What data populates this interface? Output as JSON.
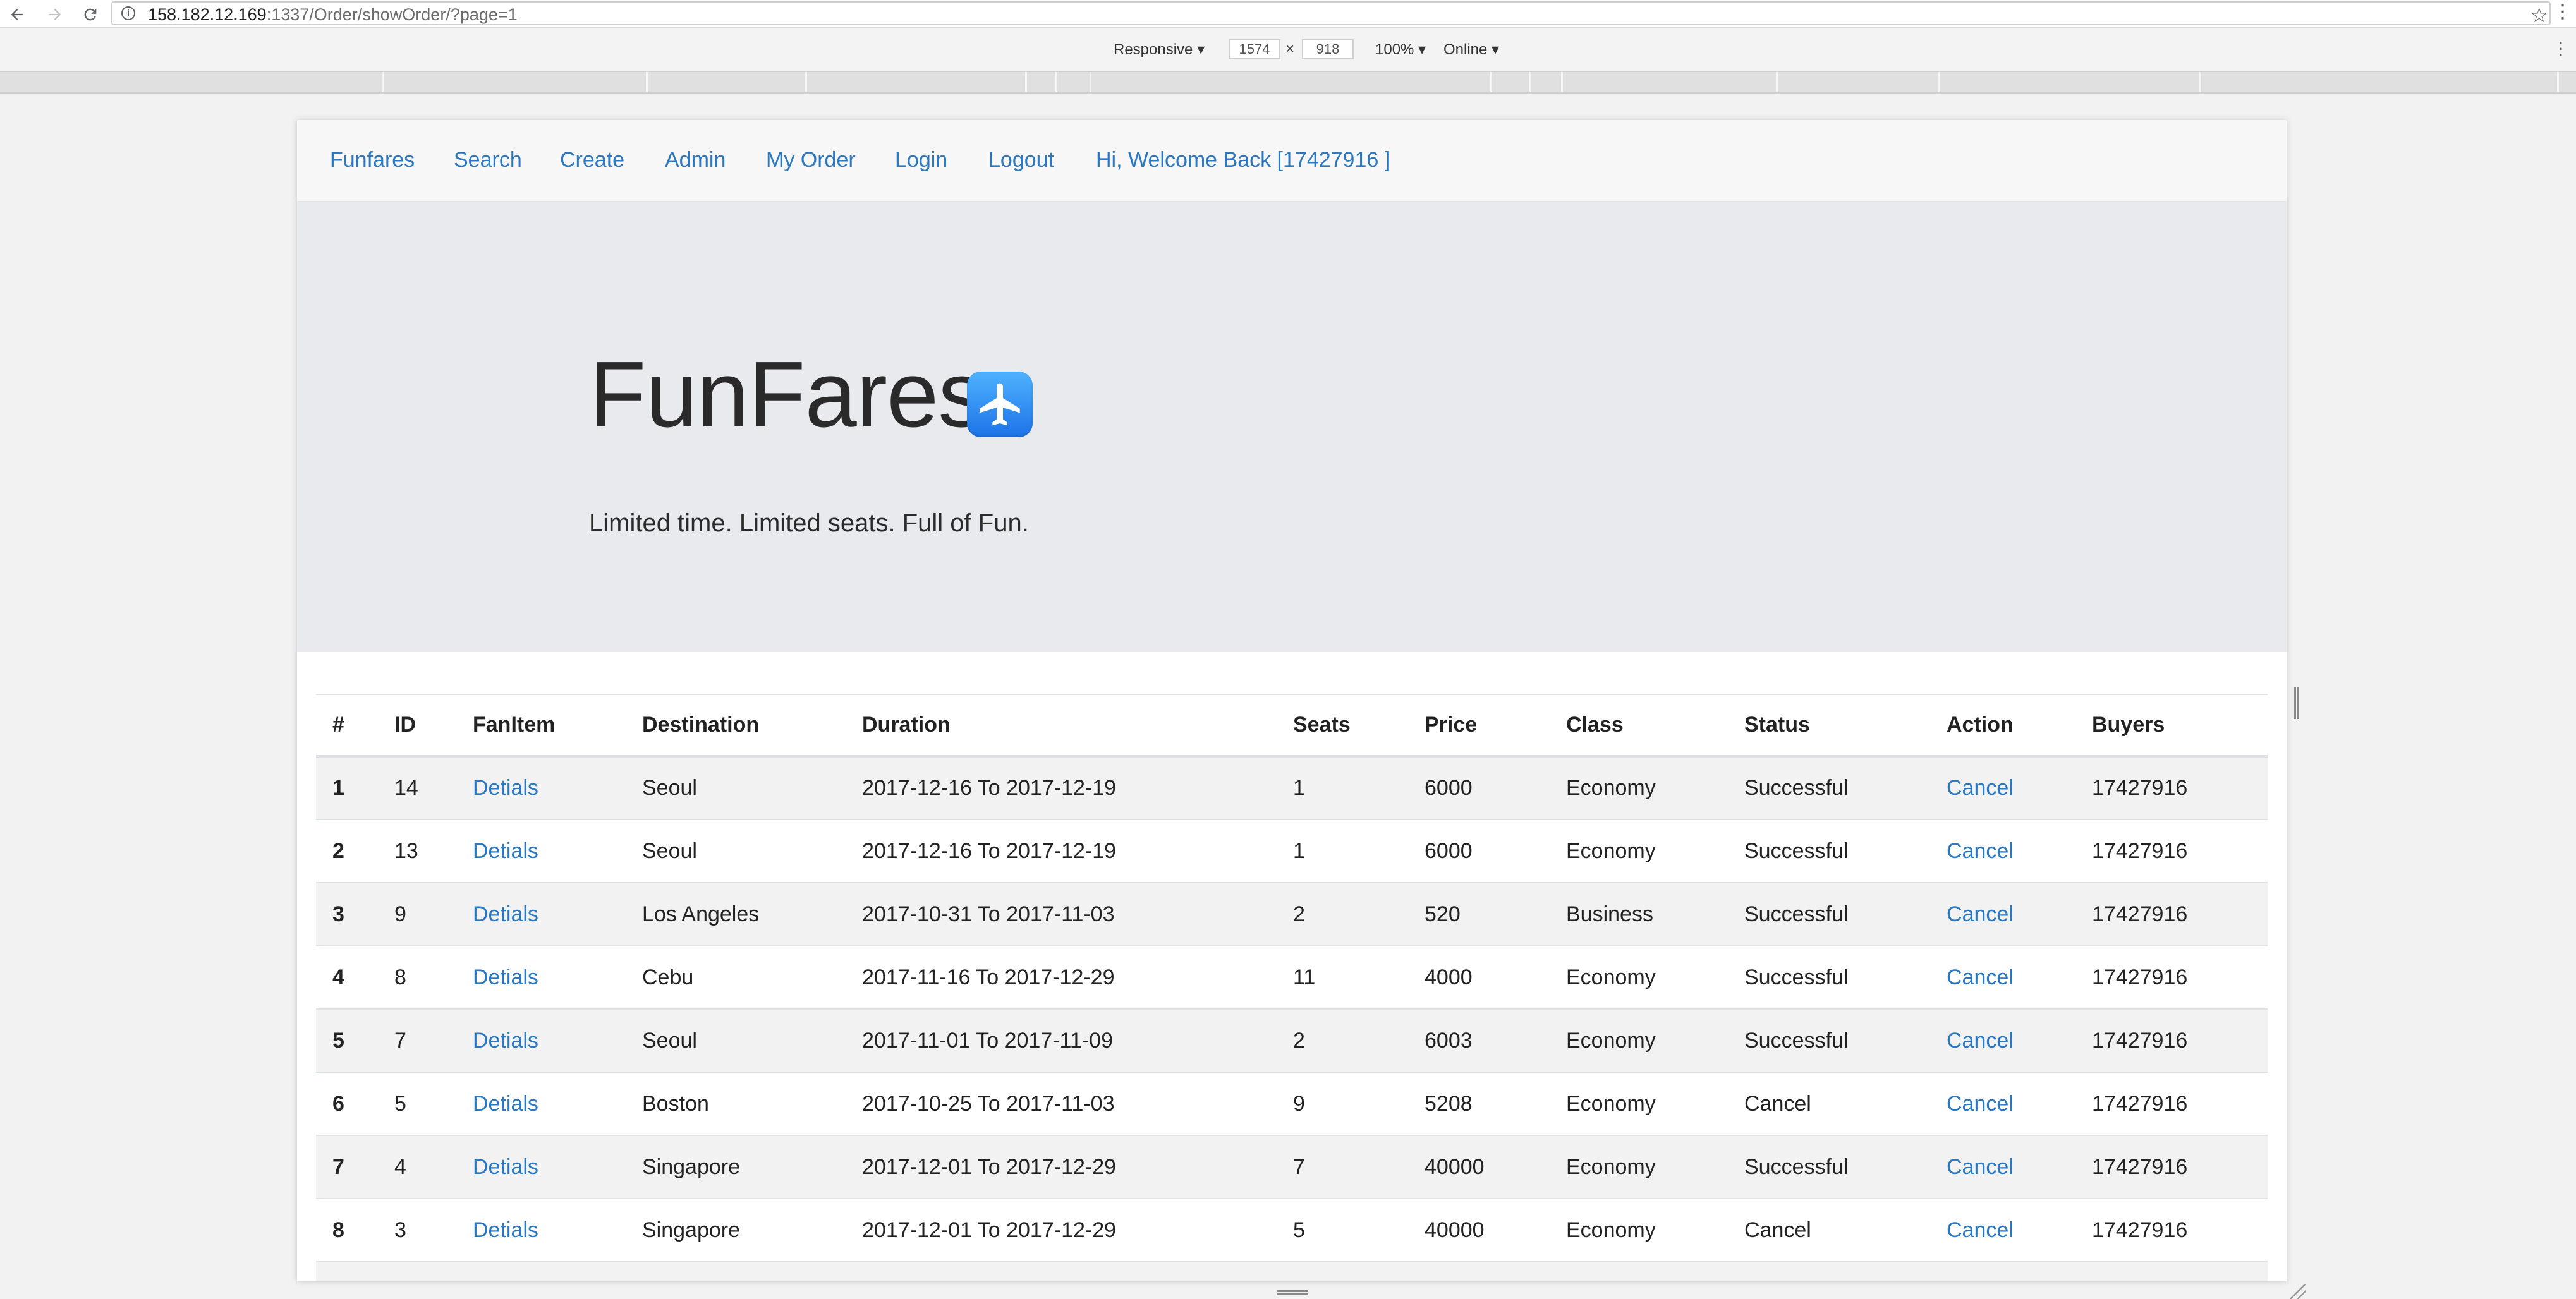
{
  "browser": {
    "url_host": "158.182.12.169",
    "url_path": ":1337/Order/showOrder/?page=1"
  },
  "device_toolbar": {
    "mode": "Responsive ▾",
    "width": "1574",
    "times": "×",
    "height": "918",
    "zoom": "100% ▾",
    "network": "Online ▾"
  },
  "navbar": {
    "items": [
      {
        "label": "Funfares"
      },
      {
        "label": "Search"
      },
      {
        "label": "Create"
      },
      {
        "label": "Admin"
      },
      {
        "label": "My Order"
      },
      {
        "label": "Login"
      },
      {
        "label": "Logout"
      },
      {
        "label": "Hi, Welcome Back [17427916 ]"
      }
    ]
  },
  "hero": {
    "title": "FunFares",
    "icon": "airplane-icon",
    "tagline": "Limited time. Limited seats. Full of Fun."
  },
  "table": {
    "headers": [
      "#",
      "ID",
      "FanItem",
      "Destination",
      "Duration",
      "Seats",
      "Price",
      "Class",
      "Status",
      "Action",
      "Buyers"
    ],
    "rows": [
      {
        "n": "1",
        "id": "14",
        "item": "Detials",
        "dest": "Seoul",
        "duration": "2017-12-16 To 2017-12-19",
        "seats": "1",
        "price": "6000",
        "cls": "Economy",
        "status": "Successful",
        "action": "Cancel",
        "buyer": "17427916"
      },
      {
        "n": "2",
        "id": "13",
        "item": "Detials",
        "dest": "Seoul",
        "duration": "2017-12-16 To 2017-12-19",
        "seats": "1",
        "price": "6000",
        "cls": "Economy",
        "status": "Successful",
        "action": "Cancel",
        "buyer": "17427916"
      },
      {
        "n": "3",
        "id": "9",
        "item": "Detials",
        "dest": "Los Angeles",
        "duration": "2017-10-31 To 2017-11-03",
        "seats": "2",
        "price": "520",
        "cls": "Business",
        "status": "Successful",
        "action": "Cancel",
        "buyer": "17427916"
      },
      {
        "n": "4",
        "id": "8",
        "item": "Detials",
        "dest": "Cebu",
        "duration": "2017-11-16 To 2017-12-29",
        "seats": "11",
        "price": "4000",
        "cls": "Economy",
        "status": "Successful",
        "action": "Cancel",
        "buyer": "17427916"
      },
      {
        "n": "5",
        "id": "7",
        "item": "Detials",
        "dest": "Seoul",
        "duration": "2017-11-01 To 2017-11-09",
        "seats": "2",
        "price": "6003",
        "cls": "Economy",
        "status": "Successful",
        "action": "Cancel",
        "buyer": "17427916"
      },
      {
        "n": "6",
        "id": "5",
        "item": "Detials",
        "dest": "Boston",
        "duration": "2017-10-25 To 2017-11-03",
        "seats": "9",
        "price": "5208",
        "cls": "Economy",
        "status": "Cancel",
        "action": "Cancel",
        "buyer": "17427916"
      },
      {
        "n": "7",
        "id": "4",
        "item": "Detials",
        "dest": "Singapore",
        "duration": "2017-12-01 To 2017-12-29",
        "seats": "7",
        "price": "40000",
        "cls": "Economy",
        "status": "Successful",
        "action": "Cancel",
        "buyer": "17427916"
      },
      {
        "n": "8",
        "id": "3",
        "item": "Detials",
        "dest": "Singapore",
        "duration": "2017-12-01 To 2017-12-29",
        "seats": "5",
        "price": "40000",
        "cls": "Economy",
        "status": "Cancel",
        "action": "Cancel",
        "buyer": "17427916"
      }
    ]
  },
  "colors": {
    "link": "#2a78c2",
    "jumbotron_bg": "#e9eaee",
    "navbar_bg": "#f7f7f7",
    "stripe": "#f2f2f2"
  }
}
